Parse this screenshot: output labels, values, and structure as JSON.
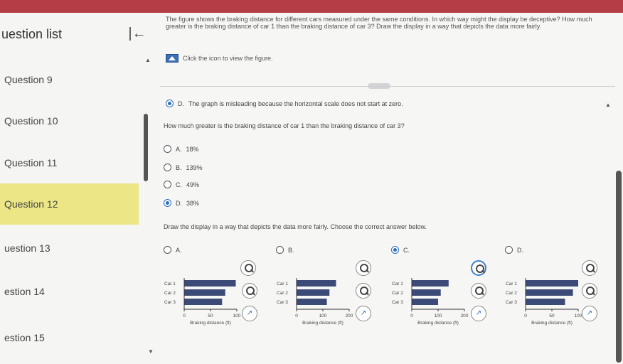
{
  "sidebar": {
    "title": "uestion list",
    "collapse_icon": "collapse-left-icon",
    "items": [
      {
        "label": "Question 9",
        "active": false
      },
      {
        "label": "Question 10",
        "active": false
      },
      {
        "label": "Question 11",
        "active": false
      },
      {
        "label": "Question 12",
        "active": true
      },
      {
        "label": "uestion 13",
        "active": false
      },
      {
        "label": "estion 14",
        "active": false
      },
      {
        "label": "estion 15",
        "active": false
      }
    ]
  },
  "question": {
    "prompt": "The figure shows the braking distance for different cars measured under the same conditions. In which way might the display be deceptive? How much greater is the braking distance of car 1 than the braking distance of car 3? Draw the display in a way that depicts the data more fairly.",
    "figure_link": "Click the icon to view the figure.",
    "previous_answer": {
      "letter": "D.",
      "text": "The graph is misleading because the horizontal scale does not start at zero."
    },
    "part2_text": "How much greater is the braking distance of car 1 than the braking distance of car 3?",
    "options": [
      {
        "letter": "A.",
        "text": "18%",
        "selected": false
      },
      {
        "letter": "B.",
        "text": "139%",
        "selected": false
      },
      {
        "letter": "C.",
        "text": "49%",
        "selected": false
      },
      {
        "letter": "D.",
        "text": "38%",
        "selected": true
      }
    ],
    "part3_text": "Draw the display in a way that depicts the data more fairly. Choose the correct answer below.",
    "graph_options": [
      {
        "letter": "A.",
        "selected": false,
        "xticks": [
          "0",
          "50",
          "100"
        ],
        "values": [
          98,
          78,
          72
        ],
        "xmax": 100
      },
      {
        "letter": "B.",
        "selected": false,
        "xticks": [
          "0",
          "100",
          "200"
        ],
        "values": [
          150,
          125,
          115
        ],
        "xmax": 200
      },
      {
        "letter": "C.",
        "selected": true,
        "xticks": [
          "0",
          "100",
          "200"
        ],
        "values": [
          140,
          110,
          100
        ],
        "xmax": 200
      },
      {
        "letter": "D.",
        "selected": false,
        "xticks": [
          "0",
          "50",
          "100"
        ],
        "values": [
          100,
          90,
          75
        ],
        "xmax": 100
      }
    ],
    "car_labels": [
      "Car 1",
      "Car 2",
      "Car 3"
    ],
    "xlabel": "Braking distance (ft)"
  },
  "colors": {
    "bar": "#3c4a78",
    "selected_row": "#ece686",
    "topbar": "#b43e46"
  }
}
